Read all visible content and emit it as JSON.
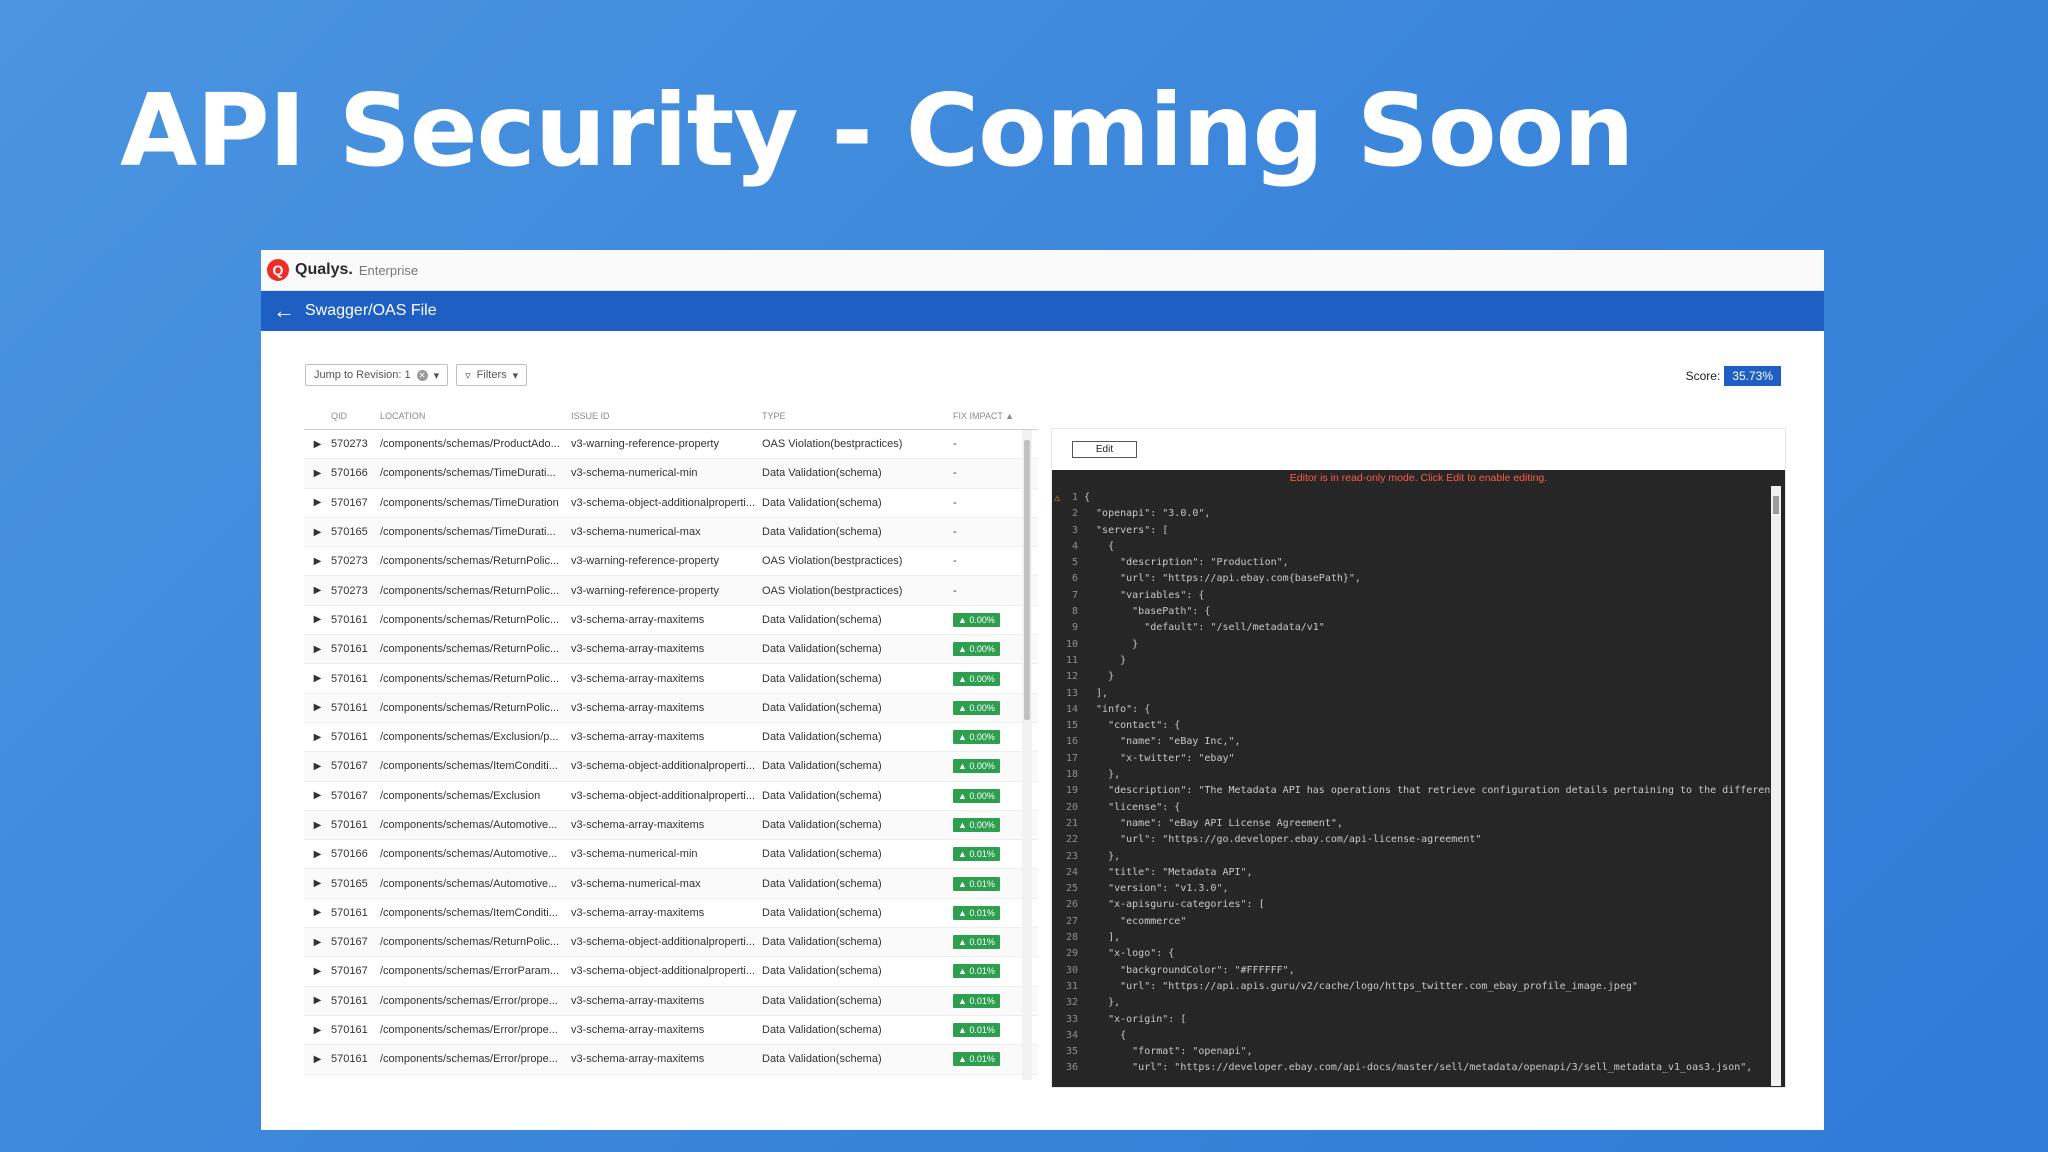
{
  "slide": {
    "title": "API Security - Coming Soon"
  },
  "app": {
    "brand": {
      "logo_letter": "Q",
      "name": "Qualys.",
      "edition": "Enterprise"
    },
    "nav": {
      "back_icon": "arrow-left-icon",
      "title": "Swagger/OAS File"
    },
    "toolbar": {
      "revision_label": "Jump to Revision: 1",
      "filters_label": "Filters"
    },
    "score": {
      "label": "Score:",
      "value": "35.73%"
    },
    "table": {
      "columns": [
        "QID",
        "LOCATION",
        "ISSUE ID",
        "TYPE",
        "FIX IMPACT ▲"
      ],
      "rows": [
        {
          "qid": "570273",
          "location": "/components/schemas/ProductAdo...",
          "issue": "v3-warning-reference-property",
          "type": "OAS Violation(bestpractices)",
          "fix": "-"
        },
        {
          "qid": "570166",
          "location": "/components/schemas/TimeDurati...",
          "issue": "v3-schema-numerical-min",
          "type": "Data Validation(schema)",
          "fix": "-"
        },
        {
          "qid": "570167",
          "location": "/components/schemas/TimeDuration",
          "issue": "v3-schema-object-additionalproperti...",
          "type": "Data Validation(schema)",
          "fix": "-"
        },
        {
          "qid": "570165",
          "location": "/components/schemas/TimeDurati...",
          "issue": "v3-schema-numerical-max",
          "type": "Data Validation(schema)",
          "fix": "-"
        },
        {
          "qid": "570273",
          "location": "/components/schemas/ReturnPolic...",
          "issue": "v3-warning-reference-property",
          "type": "OAS Violation(bestpractices)",
          "fix": "-"
        },
        {
          "qid": "570273",
          "location": "/components/schemas/ReturnPolic...",
          "issue": "v3-warning-reference-property",
          "type": "OAS Violation(bestpractices)",
          "fix": "-"
        },
        {
          "qid": "570161",
          "location": "/components/schemas/ReturnPolic...",
          "issue": "v3-schema-array-maxitems",
          "type": "Data Validation(schema)",
          "fix": "▲ 0.00%"
        },
        {
          "qid": "570161",
          "location": "/components/schemas/ReturnPolic...",
          "issue": "v3-schema-array-maxitems",
          "type": "Data Validation(schema)",
          "fix": "▲ 0.00%"
        },
        {
          "qid": "570161",
          "location": "/components/schemas/ReturnPolic...",
          "issue": "v3-schema-array-maxitems",
          "type": "Data Validation(schema)",
          "fix": "▲ 0.00%"
        },
        {
          "qid": "570161",
          "location": "/components/schemas/ReturnPolic...",
          "issue": "v3-schema-array-maxitems",
          "type": "Data Validation(schema)",
          "fix": "▲ 0.00%"
        },
        {
          "qid": "570161",
          "location": "/components/schemas/Exclusion/p...",
          "issue": "v3-schema-array-maxitems",
          "type": "Data Validation(schema)",
          "fix": "▲ 0.00%"
        },
        {
          "qid": "570167",
          "location": "/components/schemas/ItemConditi...",
          "issue": "v3-schema-object-additionalproperti...",
          "type": "Data Validation(schema)",
          "fix": "▲ 0.00%"
        },
        {
          "qid": "570167",
          "location": "/components/schemas/Exclusion",
          "issue": "v3-schema-object-additionalproperti...",
          "type": "Data Validation(schema)",
          "fix": "▲ 0.00%"
        },
        {
          "qid": "570161",
          "location": "/components/schemas/Automotive...",
          "issue": "v3-schema-array-maxitems",
          "type": "Data Validation(schema)",
          "fix": "▲ 0.00%"
        },
        {
          "qid": "570166",
          "location": "/components/schemas/Automotive...",
          "issue": "v3-schema-numerical-min",
          "type": "Data Validation(schema)",
          "fix": "▲ 0.01%"
        },
        {
          "qid": "570165",
          "location": "/components/schemas/Automotive...",
          "issue": "v3-schema-numerical-max",
          "type": "Data Validation(schema)",
          "fix": "▲ 0.01%"
        },
        {
          "qid": "570161",
          "location": "/components/schemas/ItemConditi...",
          "issue": "v3-schema-array-maxitems",
          "type": "Data Validation(schema)",
          "fix": "▲ 0.01%"
        },
        {
          "qid": "570167",
          "location": "/components/schemas/ReturnPolic...",
          "issue": "v3-schema-object-additionalproperti...",
          "type": "Data Validation(schema)",
          "fix": "▲ 0.01%"
        },
        {
          "qid": "570167",
          "location": "/components/schemas/ErrorParam...",
          "issue": "v3-schema-object-additionalproperti...",
          "type": "Data Validation(schema)",
          "fix": "▲ 0.01%"
        },
        {
          "qid": "570161",
          "location": "/components/schemas/Error/prope...",
          "issue": "v3-schema-array-maxitems",
          "type": "Data Validation(schema)",
          "fix": "▲ 0.01%"
        },
        {
          "qid": "570161",
          "location": "/components/schemas/Error/prope...",
          "issue": "v3-schema-array-maxitems",
          "type": "Data Validation(schema)",
          "fix": "▲ 0.01%"
        },
        {
          "qid": "570161",
          "location": "/components/schemas/Error/prope...",
          "issue": "v3-schema-array-maxitems",
          "type": "Data Validation(schema)",
          "fix": "▲ 0.01%"
        }
      ]
    },
    "editor": {
      "edit_label": "Edit",
      "readonly_message": "Editor is in read-only mode. Click Edit to enable editing.",
      "lines": [
        "{",
        "  \"openapi\": \"3.0.0\",",
        "  \"servers\": [",
        "    {",
        "      \"description\": \"Production\",",
        "      \"url\": \"https://api.ebay.com{basePath}\",",
        "      \"variables\": {",
        "        \"basePath\": {",
        "          \"default\": \"/sell/metadata/v1\"",
        "        }",
        "      }",
        "    }",
        "  ],",
        "  \"info\": {",
        "    \"contact\": {",
        "      \"name\": \"eBay Inc,\",",
        "      \"x-twitter\": \"ebay\"",
        "    },",
        "    \"description\": \"The Metadata API has operations that retrieve configuration details pertaining to the different",
        "    \"license\": {",
        "      \"name\": \"eBay API License Agreement\",",
        "      \"url\": \"https://go.developer.ebay.com/api-license-agreement\"",
        "    },",
        "    \"title\": \"Metadata API\",",
        "    \"version\": \"v1.3.0\",",
        "    \"x-apisguru-categories\": [",
        "      \"ecommerce\"",
        "    ],",
        "    \"x-logo\": {",
        "      \"backgroundColor\": \"#FFFFFF\",",
        "      \"url\": \"https://api.apis.guru/v2/cache/logo/https_twitter.com_ebay_profile_image.jpeg\"",
        "    },",
        "    \"x-origin\": [",
        "      {",
        "        \"format\": \"openapi\",",
        "        \"url\": \"https://developer.ebay.com/api-docs/master/sell/metadata/openapi/3/sell_metadata_v1_oas3.json\","
      ]
    }
  }
}
